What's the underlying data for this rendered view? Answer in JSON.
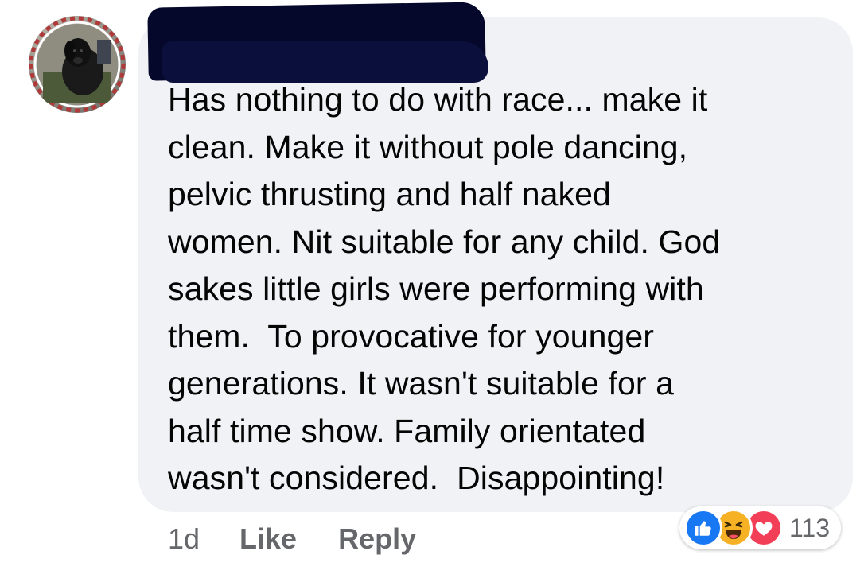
{
  "comment": {
    "text": "Has nothing to do with race... make it\nclean. Make it without pole dancing,\npelvic thrusting and half naked\nwomen. Nit suitable for any child. God\nsakes little girls were performing with\nthem.  To provocative for younger\ngenerations. It wasn't suitable for a\nhalf time show. Family orientated\nwasn't considered.  Disappointing!",
    "time": "1d",
    "like_label": "Like",
    "reply_label": "Reply"
  },
  "reactions": {
    "count": "113",
    "icons": [
      "like-icon",
      "haha-icon",
      "love-icon"
    ]
  },
  "colors": {
    "bubble": "#f0f2f5",
    "like": "#1877f2",
    "haha": "#f7b125",
    "love": "#f33e58",
    "meta_text": "#65676b",
    "redaction": "#05082b"
  }
}
